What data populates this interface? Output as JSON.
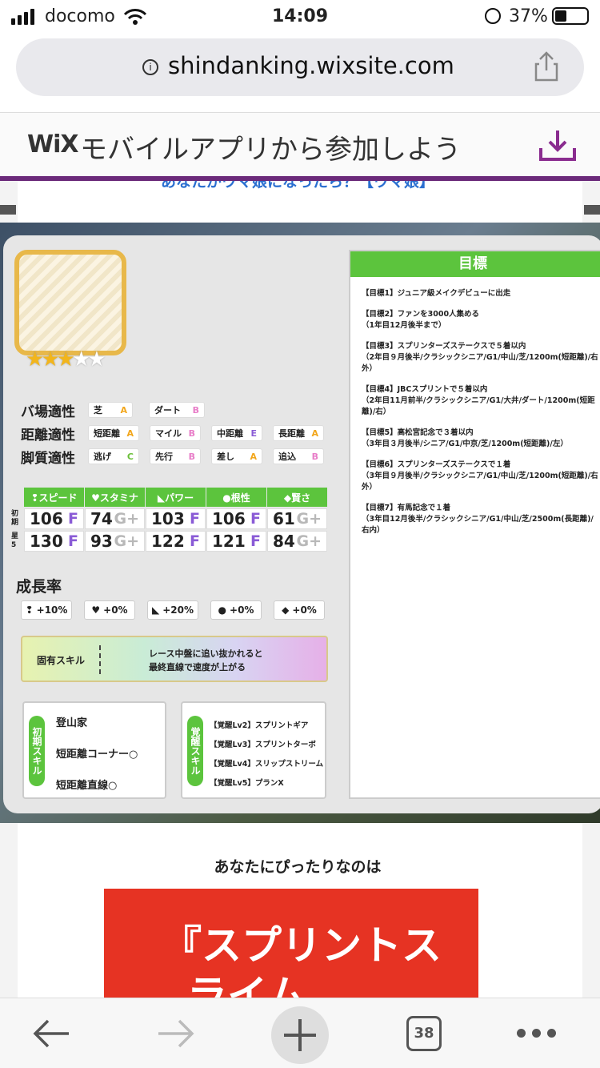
{
  "status_bar": {
    "carrier": "docomo",
    "time": "14:09",
    "battery": "37%"
  },
  "browser": {
    "url": "shindanking.wixsite.com"
  },
  "wix_banner": {
    "logo": "WiX",
    "text": "モバイルアプリから参加しよう"
  },
  "page": {
    "partial_heading": "あなたがウマ娘になったら？【ウマ娘】",
    "aptitude": {
      "rows": [
        {
          "label": "バ場適性",
          "items": [
            {
              "name": "芝",
              "grade": "A"
            },
            {
              "name": "ダート",
              "grade": "B"
            }
          ]
        },
        {
          "label": "距離適性",
          "items": [
            {
              "name": "短距離",
              "grade": "A"
            },
            {
              "name": "マイル",
              "grade": "B"
            },
            {
              "name": "中距離",
              "grade": "E"
            },
            {
              "name": "長距離",
              "grade": "A"
            }
          ]
        },
        {
          "label": "脚質適性",
          "items": [
            {
              "name": "逃げ",
              "grade": "C"
            },
            {
              "name": "先行",
              "grade": "B"
            },
            {
              "name": "差し",
              "grade": "A"
            },
            {
              "name": "追込",
              "grade": "B"
            }
          ]
        }
      ]
    },
    "stars": {
      "filled": 3,
      "total": 5
    },
    "stats": {
      "headers": [
        "スピード",
        "スタミナ",
        "パワー",
        "根性",
        "賢さ"
      ],
      "row_label_1": "初期",
      "row_label_2": "星5",
      "initial": [
        {
          "v": "106",
          "r": "F"
        },
        {
          "v": "74",
          "r": "G+"
        },
        {
          "v": "103",
          "r": "F"
        },
        {
          "v": "106",
          "r": "F"
        },
        {
          "v": "61",
          "r": "G+"
        }
      ],
      "star5": [
        {
          "v": "130",
          "r": "F"
        },
        {
          "v": "93",
          "r": "G+"
        },
        {
          "v": "122",
          "r": "F"
        },
        {
          "v": "121",
          "r": "F"
        },
        {
          "v": "84",
          "r": "G+"
        }
      ]
    },
    "growth": {
      "title": "成長率",
      "values": [
        "+10%",
        "+0%",
        "+20%",
        "+0%",
        "+0%"
      ]
    },
    "unique_skill": {
      "label": "固有スキル",
      "desc1": "レース中盤に追い抜かれると",
      "desc2": "最終直線で速度が上がる"
    },
    "initial_skills": {
      "tag": "初期スキル",
      "items": [
        "登山家",
        "短距離コーナー○",
        "短距離直線○"
      ]
    },
    "awakening_skills": {
      "tag": "覚醒スキル",
      "items": [
        "【覚醒Lv2】スプリントギア",
        "【覚醒Lv3】スプリントターボ",
        "【覚醒Lv4】スリップストリーム",
        "【覚醒Lv5】プランX"
      ]
    },
    "objectives": {
      "title": "目標",
      "items": [
        "【目標1】ジュニア級メイクデビューに出走",
        "【目標2】ファンを3000人集める\n（1年目12月後半まで）",
        "【目標3】スプリンターズステークスで５着以内\n（2年目９月後半/クラシックシニア/G1/中山/芝/1200m(短距離)/右外）",
        "【目標4】JBCスプリントで５着以内\n（2年目11月前半/クラシックシニア/G1/大井/ダート/1200m(短距離)/右）",
        "【目標5】高松宮記念で３着以内\n（3年目３月後半/シニア/G1/中京/芝/1200m(短距離)/左）",
        "【目標6】スプリンターズステークスで１着\n（3年目９月後半/クラシックシニア/G1/中山/芝/1200m(短距離)/右外）",
        "【目標7】有馬記念で１着\n（3年目12月後半/クラシックシニア/G1/中山/芝/2500m(長距離)/右内）"
      ]
    },
    "result_intro": "あなたにぴったりなのは",
    "result_title": "『スプリントス",
    "result_title_line2": "ライム"
  },
  "toolbar": {
    "tabs_count": "38"
  },
  "colors": {
    "green": "#5cc43d",
    "purple": "#6b2a7a",
    "red": "#e63323"
  }
}
